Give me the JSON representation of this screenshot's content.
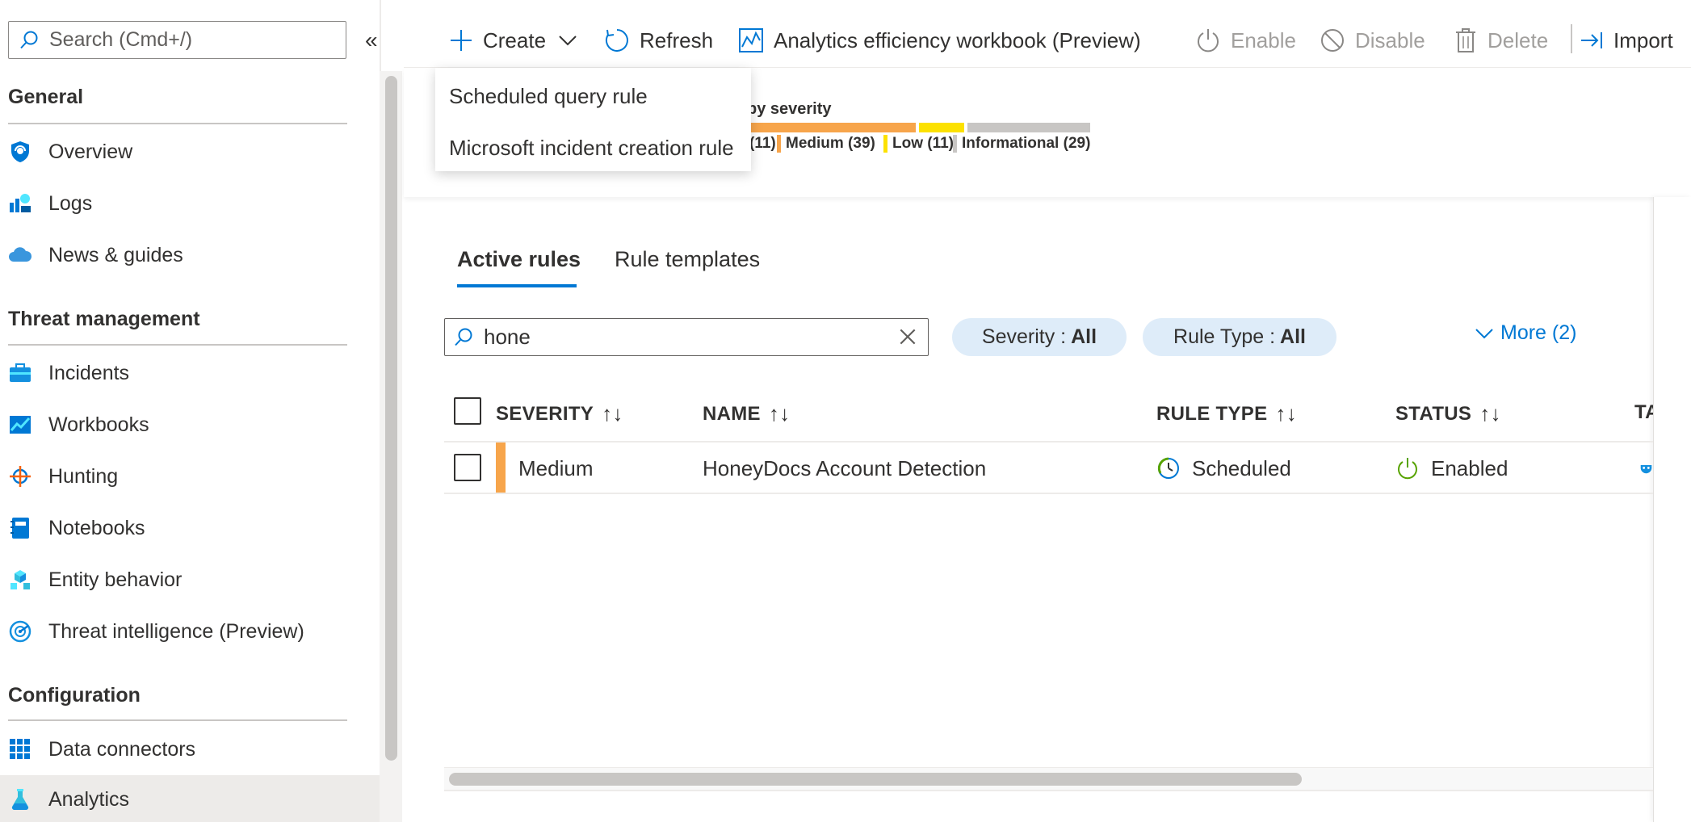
{
  "sidebar": {
    "search_placeholder": "Search (Cmd+/)",
    "collapse_glyph": "«",
    "sections": {
      "general": "General",
      "threat_management": "Threat management",
      "configuration": "Configuration"
    },
    "items": {
      "overview": "Overview",
      "logs": "Logs",
      "news": "News & guides",
      "incidents": "Incidents",
      "workbooks": "Workbooks",
      "hunting": "Hunting",
      "notebooks": "Notebooks",
      "entity": "Entity behavior",
      "threat_intel": "Threat intelligence (Preview)",
      "data_connectors": "Data connectors",
      "analytics": "Analytics"
    },
    "selected_item": "Analytics"
  },
  "toolbar": {
    "create": "Create",
    "refresh": "Refresh",
    "workbook": "Analytics efficiency workbook (Preview)",
    "enable": "Enable",
    "disable": "Disable",
    "delete": "Delete",
    "import": "Import"
  },
  "create_menu": {
    "items": [
      "Scheduled query rule",
      "Microsoft incident creation rule"
    ]
  },
  "severity_summary": {
    "title": "by severity",
    "high_count": "(11)",
    "medium": "Medium (39)",
    "low": "Low (11)",
    "informational": "Informational (29)",
    "colors": {
      "medium": "#f7a54b",
      "low": "#fce100",
      "informational": "#c8c6c4"
    }
  },
  "tabs": {
    "active": "Active rules",
    "templates": "Rule templates"
  },
  "filter": {
    "value": "hone",
    "severity_label": "Severity : ",
    "severity_value": "All",
    "ruletype_label": "Rule Type : ",
    "ruletype_value": "All",
    "more": "More (2)"
  },
  "table": {
    "headers": {
      "severity": "SEVERITY",
      "name": "NAME",
      "rule_type": "RULE TYPE",
      "status": "STATUS",
      "tactics_partial": "TA"
    },
    "sort_glyph": "↑↓",
    "rows": [
      {
        "severity": "Medium",
        "name": "HoneyDocs Account Detection",
        "rule_type": "Scheduled",
        "status": "Enabled"
      }
    ]
  },
  "accent_color": "#0078d4"
}
